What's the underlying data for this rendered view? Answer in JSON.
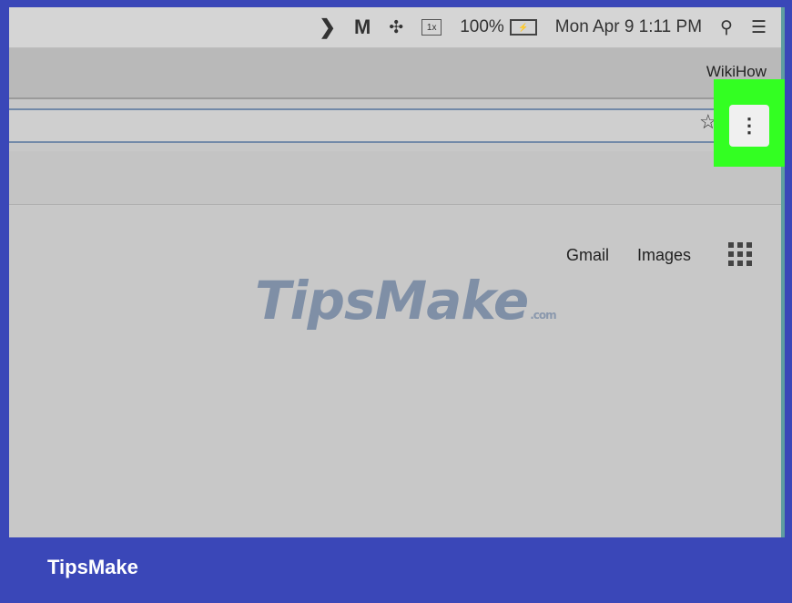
{
  "menubar": {
    "chevron_glyph": "❯",
    "malware_glyph": "M",
    "move_glyph": "✣",
    "display_label": "1x",
    "battery_percent": "100%",
    "battery_label": "⚡",
    "datetime": "Mon Apr 9  1:11 PM",
    "search_glyph": "⚲",
    "list_glyph": "☰"
  },
  "browser": {
    "profile_name": "WikiHow",
    "star_glyph": "☆",
    "menu_glyph": "⋮"
  },
  "page": {
    "gmail_link": "Gmail",
    "images_link": "Images"
  },
  "watermark": {
    "brand": "TipsMake",
    "suffix": ".com"
  },
  "footer": {
    "brand": "TipsMake"
  },
  "colors": {
    "highlight": "#33ff22",
    "footer": "#3a47b8"
  }
}
